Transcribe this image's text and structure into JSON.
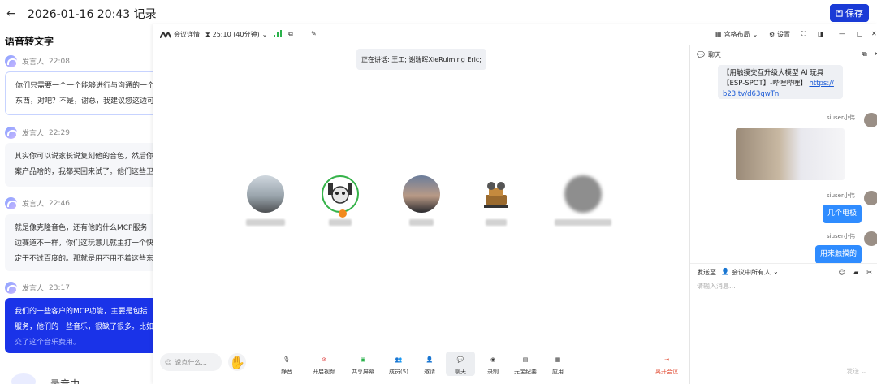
{
  "header": {
    "title": "2026-01-16 20:43 记录",
    "save_label": "保存"
  },
  "transcript": {
    "heading": "语音转文字",
    "entries": [
      {
        "speaker": "发言人",
        "time": "22:08",
        "lines": [
          "你们只需要一个一个能够进行与沟通的一个",
          "东西，对吧？不是，谢总，我建议您这边可"
        ]
      },
      {
        "speaker": "发言人",
        "time": "22:29",
        "lines": [
          "其实你可以说家长说复刻他的音色，然后你",
          "案产品啥的，我都买回来试了。他们这些卫"
        ]
      },
      {
        "speaker": "发言人",
        "time": "22:46",
        "lines": [
          "就是像克隆音色，还有他的什么MCP服务",
          "边赛道不一样，你们这玩意儿就主打一个快",
          "定干不过百度的。那就是用不用不着这些东"
        ]
      },
      {
        "speaker": "发言人",
        "time": "23:17",
        "lines": [
          "我们的一些客户的MCP功能，主要是包括",
          "服务，他们的一些音乐，很缺了很多。比如",
          "交了这个音乐费用。"
        ]
      }
    ],
    "recording": "录音中"
  },
  "meeting": {
    "info_label": "会议详情",
    "timer": "25:10 (40分钟)",
    "layout_label": "宫格布局",
    "settings_label": "设置",
    "speaking": "正在讲话: 王工; 谢瑞晖XieRuiming Eric;",
    "toolbar": {
      "say_placeholder": "说点什么...",
      "mute": "静音",
      "video": "开启视频",
      "share": "共享屏幕",
      "members": "成员(5)",
      "invite": "邀请",
      "chat": "聊天",
      "record": "录制",
      "minutes": "元宝纪要",
      "apps": "应用",
      "leave": "离开会议"
    }
  },
  "chat": {
    "title": "聊天",
    "link_msg": [
      "【用触摸交互升级大模型 AI 玩具",
      "【ESP-SPOT】-哔哩哔哩】",
      "b23.tv/d63qwTn"
    ],
    "link_url": "https://",
    "user": "siuser小伟",
    "msg1": "几个电极",
    "msg2": "用来触摸的",
    "send_to": "发送至",
    "send_target": "会议中所有人",
    "input_placeholder": "请输入消息...",
    "send": "发送"
  },
  "colors": {
    "accent": "#1a3bd6",
    "active_msg": "#1a33e8",
    "chat_bubble": "#2f8cff",
    "leave": "#e0452b"
  }
}
